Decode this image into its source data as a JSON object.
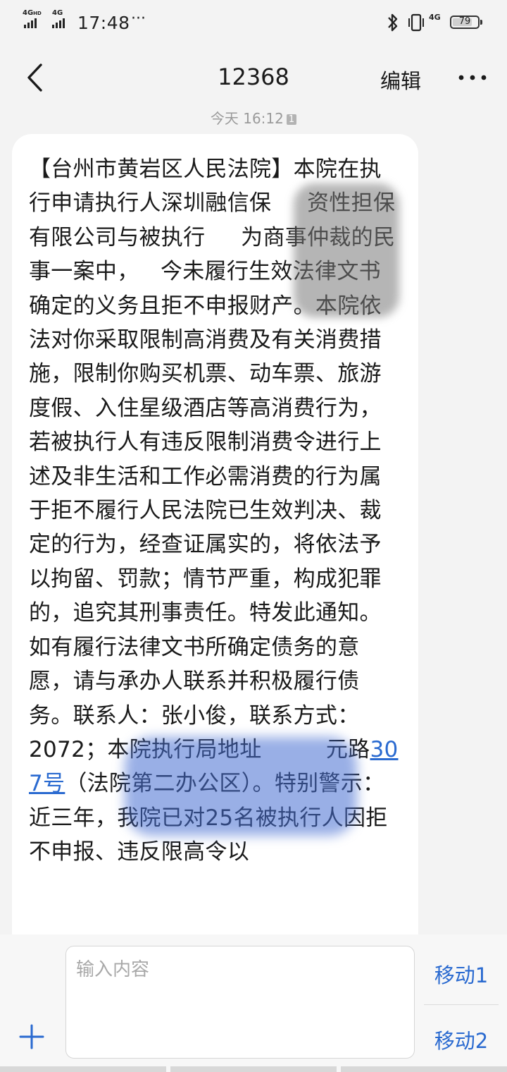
{
  "status_bar": {
    "network_1": "4G",
    "network_1_sub": "HD",
    "network_2": "4G",
    "time": "17:48",
    "more": "···",
    "network_right": "4G",
    "battery": "79",
    "battery_level": 0.79
  },
  "nav": {
    "title": "12368",
    "edit_label": "编辑"
  },
  "message": {
    "timestamp": "今天 16:12",
    "sim_badge": "1",
    "text_part1": "【台州市黄岩区人民法院】本院在执行申请执行人深圳融信保     资性担保有限公司与被执行     为商事仲裁的民事一案中，   今未履行生效法律文书确定的义务且拒不申报财产。本院依法对你采取限制高消费及有关消费措施，限制你购买机票、动车票、旅游度假、入住星级酒店等高消费行为，若被执行人有违反限制消费令进行上述及非生活和工作必需消费的行为属于拒不履行人民法院已生效判决、裁定的行为，经查证属实的，将依法予以拘留、罚款；情节严重，构成犯罪的，追究其刑事责任。特发此通知。如有履行法律文书所确定债务的意愿，请与承办人联系并积极履行债务。联系人：张小俊，联系方式：       2072；本院执行局地址         元路",
    "link_text": "307号",
    "text_part2": "（法院第二办公区）。特别警示：近三年，我院已对25名被执行人因拒不申报、违反限高令以"
  },
  "input": {
    "placeholder": "输入内容",
    "move1_label": "移动1",
    "move2_label": "移动2"
  },
  "colors": {
    "accent": "#2a6ad0",
    "background": "#f3f3f3",
    "bubble": "#ffffff"
  },
  "icons": [
    "back-arrow-icon",
    "more-icon",
    "bluetooth-icon",
    "vibrate-icon",
    "plus-icon"
  ]
}
